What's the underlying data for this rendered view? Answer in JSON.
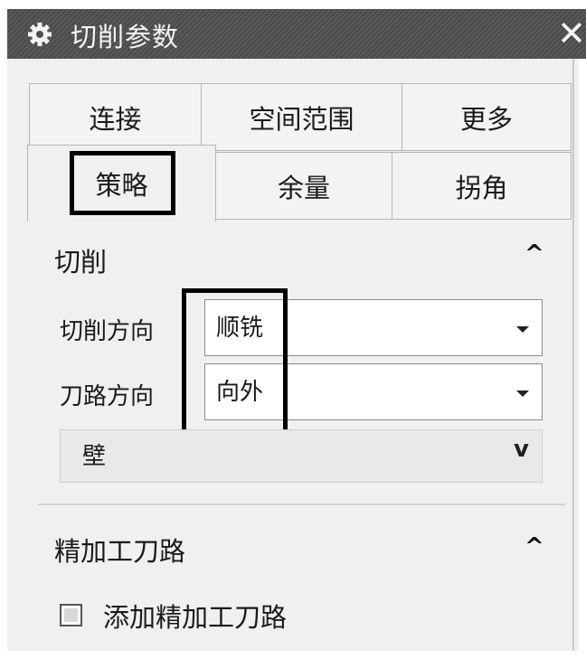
{
  "window": {
    "title": "切削参数"
  },
  "tabs_row1": [
    {
      "label": "连接"
    },
    {
      "label": "空间范围"
    },
    {
      "label": "更多"
    }
  ],
  "tabs_row2": [
    {
      "label": "策略"
    },
    {
      "label": "余量"
    },
    {
      "label": "拐角"
    }
  ],
  "active_tab": "策略",
  "cut_section": {
    "title": "切削",
    "cut_direction": {
      "label": "切削方向",
      "value": "顺铣"
    },
    "toolpath_direction": {
      "label": "刀路方向",
      "value": "向外"
    },
    "wall_group": {
      "label": "壁"
    }
  },
  "finish_section": {
    "title": "精加工刀路",
    "add_finish_checkbox": {
      "label": "添加精加工刀路",
      "checked": false
    }
  },
  "icons": {
    "title": "gear-icon",
    "close": "close-icon",
    "collapse": "chevron-up-icon",
    "expand": "chevron-down-icon",
    "dropdown": "dropdown-caret-icon"
  }
}
